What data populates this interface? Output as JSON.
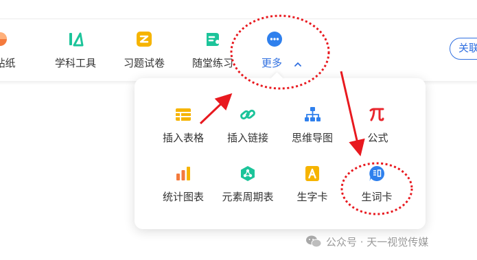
{
  "toolbar": {
    "items": [
      {
        "label": "层贴纸",
        "icon": "sticker-icon"
      },
      {
        "label": "学科工具",
        "icon": "subject-tools-icon"
      },
      {
        "label": "习题试卷",
        "icon": "exercise-paper-icon"
      },
      {
        "label": "随堂练习",
        "icon": "class-practice-icon"
      },
      {
        "label": "更多",
        "icon": "more-icon"
      }
    ],
    "active_item": "更多",
    "follow_button": "关联"
  },
  "more_menu": {
    "items": [
      {
        "label": "插入表格",
        "icon": "table-icon"
      },
      {
        "label": "插入链接",
        "icon": "link-icon"
      },
      {
        "label": "思维导图",
        "icon": "mind-map-icon"
      },
      {
        "label": "公式",
        "icon": "pi-formula-icon"
      },
      {
        "label": "统计图表",
        "icon": "bar-chart-icon"
      },
      {
        "label": "元素周期表",
        "icon": "periodic-table-icon"
      },
      {
        "label": "生字卡",
        "icon": "character-card-icon"
      },
      {
        "label": "生词卡",
        "icon": "word-card-icon"
      }
    ]
  },
  "watermark": {
    "text": "公众号 · 天一视觉传媒"
  },
  "colors": {
    "accent_blue": "#2f6fe0",
    "annotation_red": "#e8191f",
    "icon_yellow": "#f6b400",
    "icon_green": "#1cc49a",
    "icon_orange": "#f47a3c",
    "icon_blue": "#2f80ed",
    "icon_red": "#e8262d"
  }
}
